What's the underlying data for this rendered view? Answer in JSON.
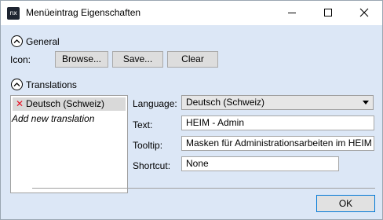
{
  "window": {
    "app_icon_text": "nx",
    "title": "Menüeintrag Eigenschaften"
  },
  "general": {
    "section_label": "General",
    "icon_label": "Icon:",
    "browse_label": "Browse...",
    "save_label": "Save...",
    "clear_label": "Clear"
  },
  "translations": {
    "section_label": "Translations",
    "items": [
      {
        "label": "Deutsch (Schweiz)",
        "status_icon": "delete-x-icon"
      }
    ],
    "add_new_label": "Add new translation"
  },
  "details": {
    "language_label": "Language:",
    "language_value": "Deutsch (Schweiz)",
    "text_label": "Text:",
    "text_value": "HEIM - Admin",
    "tooltip_label": "Tooltip:",
    "tooltip_value": "Masken für Administrationsarbeiten im HEIM",
    "shortcut_label": "Shortcut:",
    "shortcut_value": "None"
  },
  "footer": {
    "ok_label": "OK"
  },
  "colors": {
    "client_background": "#dce7f6",
    "delete_icon": "#e81123",
    "default_button_border": "#0078d7"
  }
}
